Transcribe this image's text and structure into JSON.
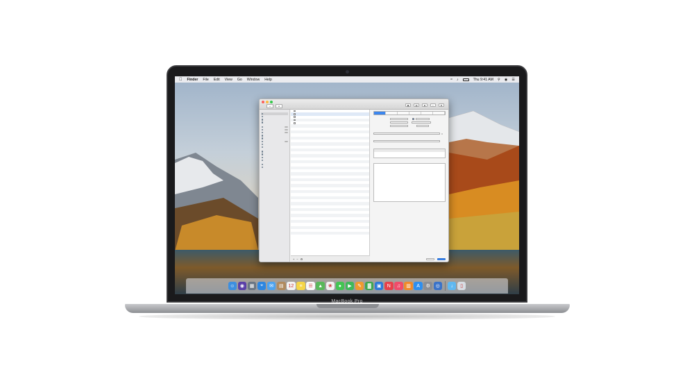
{
  "device": {
    "label": "MacBook Pro"
  },
  "menubar": {
    "apple_icon": "apple-icon",
    "app_name": "Finder",
    "items": [
      "File",
      "Edit",
      "View",
      "Go",
      "Window",
      "Help"
    ],
    "status": {
      "clock": "Thu 9:41 AM"
    }
  },
  "window": {
    "title": "",
    "sidebar": {
      "groups": [
        {
          "items": [
            "",
            "",
            "",
            ""
          ]
        },
        {
          "items": [
            "",
            "",
            "",
            "",
            "",
            "",
            "",
            ""
          ]
        },
        {
          "items": [
            "",
            "",
            "",
            ""
          ]
        },
        {
          "items": [
            "",
            ""
          ]
        }
      ]
    },
    "list": {
      "rows": [
        "",
        "",
        "",
        "",
        ""
      ],
      "empty_rows": 38
    },
    "detail": {
      "tabs": [
        "",
        "",
        "",
        "",
        "",
        ""
      ],
      "active_tab_index": 0,
      "ok_label": "",
      "cancel_label": ""
    }
  },
  "dock": {
    "apps": [
      {
        "icon": "finder-icon",
        "color": "#3d8fe0"
      },
      {
        "icon": "siri-icon",
        "color": "#5b3fa8"
      },
      {
        "icon": "launchpad-icon",
        "color": "#6a7684"
      },
      {
        "icon": "safari-icon",
        "color": "#2d86e0"
      },
      {
        "icon": "mail-icon",
        "color": "#4da3f0"
      },
      {
        "icon": "contacts-icon",
        "color": "#b08a5e"
      },
      {
        "icon": "calendar-icon",
        "color": "#f3f3f3"
      },
      {
        "icon": "notes-icon",
        "color": "#f5d547"
      },
      {
        "icon": "reminders-icon",
        "color": "#fafafa"
      },
      {
        "icon": "maps-icon",
        "color": "#59b85a"
      },
      {
        "icon": "photos-icon",
        "color": "#f2f2f2"
      },
      {
        "icon": "messages-icon",
        "color": "#43c552"
      },
      {
        "icon": "facetime-icon",
        "color": "#3fb95a"
      },
      {
        "icon": "pages-icon",
        "color": "#f09a2e"
      },
      {
        "icon": "numbers-icon",
        "color": "#3ea84f"
      },
      {
        "icon": "keynote-icon",
        "color": "#2e7ad8"
      },
      {
        "icon": "news-icon",
        "color": "#e8404a"
      },
      {
        "icon": "music-icon",
        "color": "#f04c6a"
      },
      {
        "icon": "books-icon",
        "color": "#f08a2a"
      },
      {
        "icon": "app-store-icon",
        "color": "#2e8ff0"
      },
      {
        "icon": "system-preferences-icon",
        "color": "#8c8e94"
      },
      {
        "icon": "network-app-icon",
        "color": "#3a72c8"
      }
    ],
    "right": [
      {
        "icon": "downloads-folder-icon",
        "color": "#5fb8f0"
      },
      {
        "icon": "trash-icon",
        "color": "#d8dde3"
      }
    ]
  }
}
